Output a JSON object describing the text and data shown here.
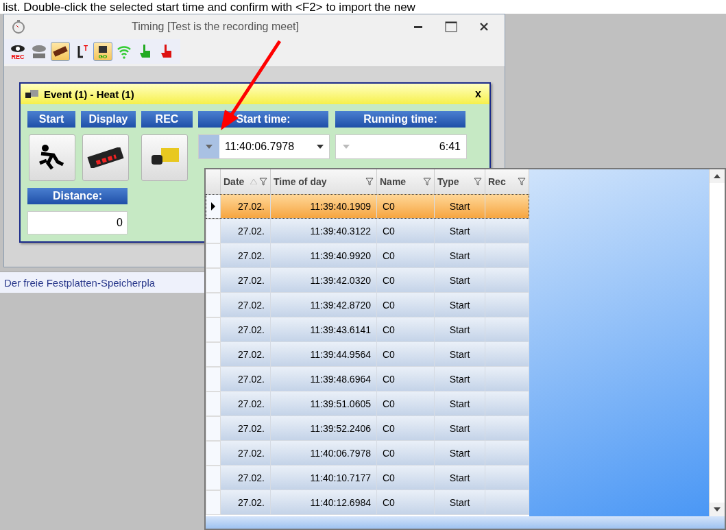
{
  "instruction_text": "list. Double-click the selected start time and confirm with <F2> to import the new",
  "window": {
    "title": "Timing [Test is the recording meet]"
  },
  "toolbar": [
    {
      "kind": "eye-rec",
      "label": "REC",
      "pressed": false
    },
    {
      "kind": "eye-display",
      "pressed": false
    },
    {
      "kind": "display",
      "pressed": true
    },
    {
      "kind": "sensor",
      "label": "T",
      "pressed": false
    },
    {
      "kind": "camera",
      "label": "GO",
      "pressed": true
    },
    {
      "kind": "wifi",
      "pressed": false
    },
    {
      "kind": "hand-green",
      "pressed": false
    },
    {
      "kind": "hand-red",
      "pressed": false
    }
  ],
  "event_panel": {
    "title": "Event (1) - Heat (1)",
    "close": "x",
    "columns": [
      {
        "label": "Start",
        "kind": "runner"
      },
      {
        "label": "Display",
        "kind": "display"
      },
      {
        "label": "REC",
        "kind": "camera"
      }
    ],
    "start_time": {
      "label": "Start time:",
      "value": "11:40:06.7978"
    },
    "running_time": {
      "label": "Running time:",
      "value": "6:41"
    },
    "distance": {
      "label": "Distance:",
      "value": "0"
    }
  },
  "status_bar": "Der freie Festplatten-Speicherpla",
  "dropdown": {
    "columns": [
      "Date",
      "Time of day",
      "Name",
      "Type",
      "Rec"
    ],
    "rows": [
      {
        "date": "27.02.",
        "time": "11:39:40.1909",
        "name": "C0",
        "type": "Start",
        "selected": true
      },
      {
        "date": "27.02.",
        "time": "11:39:40.3122",
        "name": "C0",
        "type": "Start",
        "selected": false
      },
      {
        "date": "27.02.",
        "time": "11:39:40.9920",
        "name": "C0",
        "type": "Start",
        "selected": false
      },
      {
        "date": "27.02.",
        "time": "11:39:42.0320",
        "name": "C0",
        "type": "Start",
        "selected": false
      },
      {
        "date": "27.02.",
        "time": "11:39:42.8720",
        "name": "C0",
        "type": "Start",
        "selected": false
      },
      {
        "date": "27.02.",
        "time": "11:39:43.6141",
        "name": "C0",
        "type": "Start",
        "selected": false
      },
      {
        "date": "27.02.",
        "time": "11:39:44.9564",
        "name": "C0",
        "type": "Start",
        "selected": false
      },
      {
        "date": "27.02.",
        "time": "11:39:48.6964",
        "name": "C0",
        "type": "Start",
        "selected": false
      },
      {
        "date": "27.02.",
        "time": "11:39:51.0605",
        "name": "C0",
        "type": "Start",
        "selected": false
      },
      {
        "date": "27.02.",
        "time": "11:39:52.2406",
        "name": "C0",
        "type": "Start",
        "selected": false
      },
      {
        "date": "27.02.",
        "time": "11:40:06.7978",
        "name": "C0",
        "type": "Start",
        "selected": false
      },
      {
        "date": "27.02.",
        "time": "11:40:10.7177",
        "name": "C0",
        "type": "Start",
        "selected": false
      },
      {
        "date": "27.02.",
        "time": "11:40:12.6984",
        "name": "C0",
        "type": "Start",
        "selected": false
      }
    ]
  }
}
